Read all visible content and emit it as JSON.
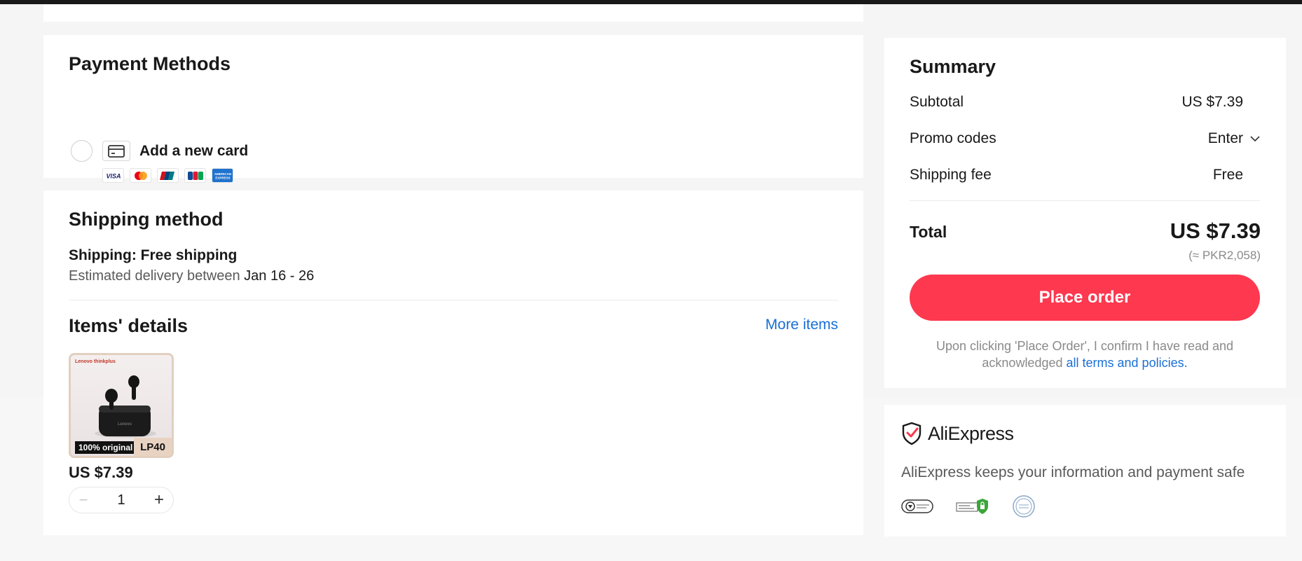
{
  "payment": {
    "title": "Payment Methods",
    "add_card_label": "Add a new card",
    "card_brands": [
      "VISA",
      "Mastercard",
      "UnionPay",
      "JCB",
      "American Express"
    ]
  },
  "shipping": {
    "title": "Shipping method",
    "shipping_line": "Shipping: Free shipping",
    "estimate_prefix": "Estimated delivery between",
    "estimate_dates": "Jan 16 - 26"
  },
  "items": {
    "title": "Items' details",
    "more_items": "More items",
    "product": {
      "brand": "Lenovo thinkplus",
      "badge": "100% original",
      "model": "LP40",
      "price": "US $7.39",
      "quantity": "1"
    }
  },
  "summary": {
    "title": "Summary",
    "subtotal_label": "Subtotal",
    "subtotal_value": "US $7.39",
    "promo_label": "Promo codes",
    "promo_value": "Enter",
    "shipping_label": "Shipping fee",
    "shipping_value": "Free",
    "total_label": "Total",
    "total_value": "US $7.39",
    "total_local": "(≈ PKR2,058)",
    "place_order": "Place order",
    "disclaimer_text": "Upon clicking 'Place Order', I confirm I have read and acknowledged",
    "disclaimer_link": "all terms and policies."
  },
  "safety": {
    "brand_name": "AliExpress",
    "message": "AliExpress keeps your information and payment safe"
  },
  "colors": {
    "accent": "#fd384f",
    "link": "#1a6fd6"
  }
}
